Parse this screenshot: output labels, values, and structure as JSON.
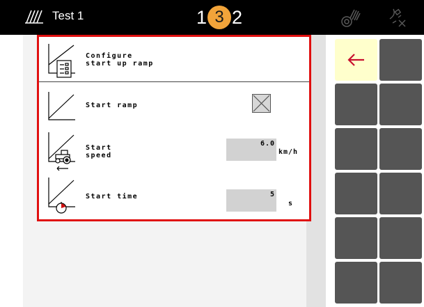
{
  "topbar": {
    "title": "Test 1",
    "step_left": "1",
    "step_badge": "3",
    "step_right": "2"
  },
  "panel": {
    "header_label": "Configure\nstart up ramp",
    "rows": [
      {
        "label": "Start ramp",
        "checked": false
      },
      {
        "label": "Start\nspeed",
        "value": "6.0",
        "unit": "km/h"
      },
      {
        "label": "Start time",
        "value": "5",
        "unit": "s"
      }
    ]
  },
  "menu": {
    "back_button": "back-arrow-icon",
    "highlight_color": "#ffffcc",
    "arrow_color": "#c8102e",
    "highlight_border_color": "#e01010"
  },
  "icons": [
    "machine-icon",
    "ramp-config-icon",
    "ramp-icon",
    "tractor-icon",
    "timer-icon",
    "section-control-icon",
    "gps-icon"
  ]
}
